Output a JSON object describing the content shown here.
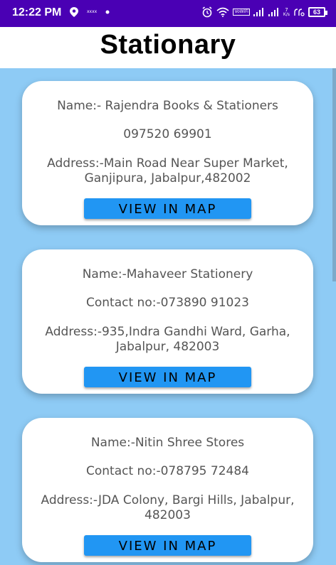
{
  "status_bar": {
    "time": "12:22 PM",
    "small_label": "xxxx",
    "network_label": "VoWiFi",
    "speed_value": "7",
    "speed_unit": "K/s",
    "battery": "63"
  },
  "app_bar": {
    "title": "Stationary"
  },
  "stores": [
    {
      "name": "Name:- Rajendra Books & Stationers",
      "contact": "097520 69901",
      "address": "Address:-Main Road Near Super Market, Ganjipura, Jabalpur,482002",
      "button": "VIEW IN MAP"
    },
    {
      "name": "Name:-Mahaveer Stationery",
      "contact": "Contact no:-073890 91023",
      "address": "Address:-935,Indra Gandhi Ward, Garha, Jabalpur, 482003",
      "button": "VIEW IN MAP"
    },
    {
      "name": "Name:-Nitin Shree Stores",
      "contact": "Contact no:-078795 72484",
      "address": "Address:-JDA Colony, Bargi Hills, Jabalpur, 482003",
      "button": "VIEW IN MAP"
    }
  ],
  "colors": {
    "status_bar": "#4a00b4",
    "background": "#8ecbf5",
    "button": "#2196f3"
  }
}
